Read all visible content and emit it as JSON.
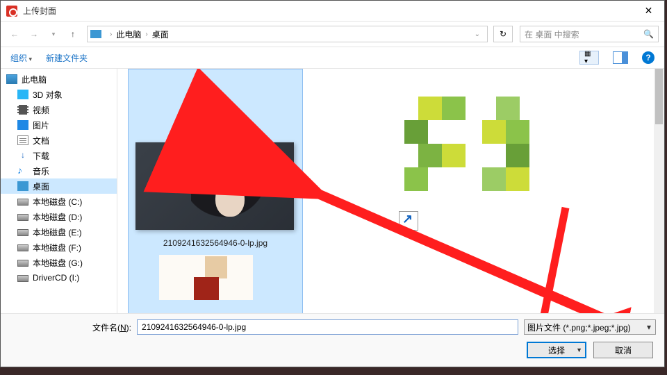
{
  "title": "上传封面",
  "breadcrumb": {
    "root": "此电脑",
    "loc": "桌面"
  },
  "search": {
    "placeholder": "在 桌面 中搜索"
  },
  "toolbar": {
    "organize": "组织",
    "newfolder": "新建文件夹"
  },
  "sidebar": {
    "items": [
      {
        "label": "此电脑",
        "ico": "ico-pc"
      },
      {
        "label": "3D 对象",
        "ico": "ico-3d"
      },
      {
        "label": "视频",
        "ico": "ico-vid"
      },
      {
        "label": "图片",
        "ico": "ico-pic"
      },
      {
        "label": "文档",
        "ico": "ico-doc"
      },
      {
        "label": "下载",
        "ico": "ico-dl",
        "glyph": "↓"
      },
      {
        "label": "音乐",
        "ico": "ico-mus",
        "glyph": "♪"
      },
      {
        "label": "桌面",
        "ico": "ico-desk",
        "sel": true
      },
      {
        "label": "本地磁盘 (C:)",
        "ico": "ico-hdd"
      },
      {
        "label": "本地磁盘 (D:)",
        "ico": "ico-hdd"
      },
      {
        "label": "本地磁盘 (E:)",
        "ico": "ico-hdd"
      },
      {
        "label": "本地磁盘 (F:)",
        "ico": "ico-hdd"
      },
      {
        "label": "本地磁盘 (G:)",
        "ico": "ico-hdd"
      },
      {
        "label": "DriverCD (I:)",
        "ico": "ico-hdd"
      }
    ]
  },
  "file": {
    "name": "2109241632564946-0-lp.jpg"
  },
  "footer": {
    "fn_label_pre": "文件名(",
    "fn_label_u": "N",
    "fn_label_post": "):",
    "fn_value": "2109241632564946-0-lp.jpg",
    "filetype": "图片文件 (*.png;*.jpeg;*.jpg)",
    "ok": "选择",
    "cancel": "取消"
  }
}
